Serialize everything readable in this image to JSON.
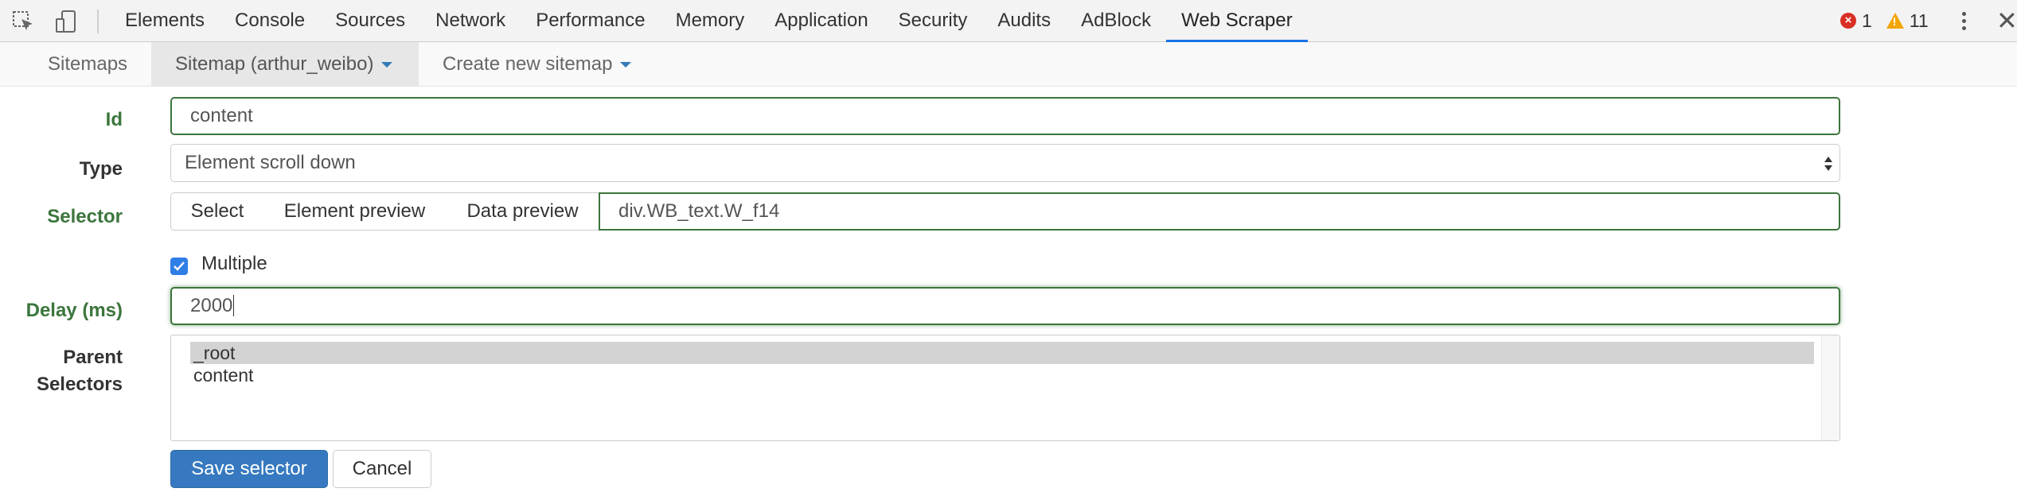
{
  "devtools": {
    "tabs": [
      "Elements",
      "Console",
      "Sources",
      "Network",
      "Performance",
      "Memory",
      "Application",
      "Security",
      "Audits",
      "AdBlock",
      "Web Scraper"
    ],
    "active_tab": "Web Scraper",
    "error_count": "1",
    "warning_count": "11",
    "icons": {
      "inspect": "inspect-element-icon",
      "device": "device-toolbar-icon",
      "menu": "more-vertical-icon",
      "close": "close-icon"
    }
  },
  "nav": {
    "sitemaps": "Sitemaps",
    "current_sitemap": "Sitemap (arthur_weibo)",
    "create": "Create new sitemap"
  },
  "form": {
    "id_label": "Id",
    "id_value": "content",
    "type_label": "Type",
    "type_value": "Element scroll down",
    "selector_label": "Selector",
    "select_btn": "Select",
    "element_preview_btn": "Element preview",
    "data_preview_btn": "Data preview",
    "selector_value": "div.WB_text.W_f14",
    "multiple_label": "Multiple",
    "multiple_checked": true,
    "delay_label": "Delay (ms)",
    "delay_value": "2000",
    "parent_label_1": "Parent",
    "parent_label_2": "Selectors",
    "parent_options": [
      "_root",
      "content"
    ],
    "parent_selected": "_root",
    "save_btn": "Save selector",
    "cancel_btn": "Cancel"
  },
  "colors": {
    "valid_green": "#3c763d",
    "primary_blue": "#3679c0",
    "active_tab_underline": "#1a73e8"
  }
}
